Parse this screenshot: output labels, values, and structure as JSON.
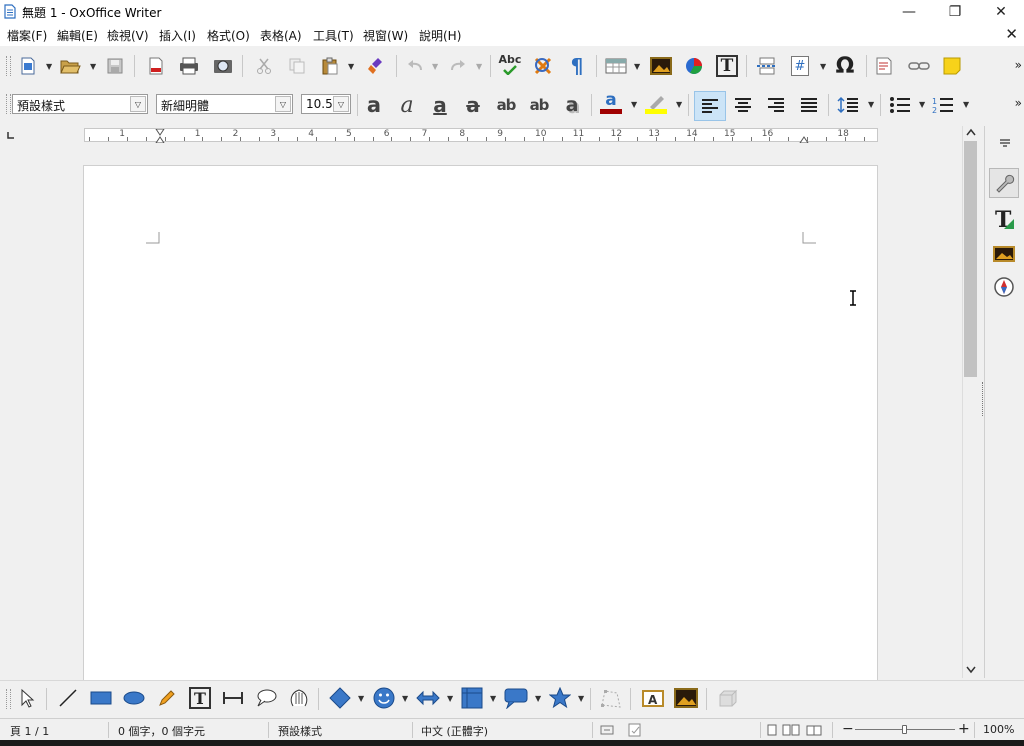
{
  "window": {
    "title": "無題 1 - OxOffice Writer",
    "minimize_glyph": "—",
    "restore_glyph": "❐",
    "close_glyph": "✕"
  },
  "menu": {
    "items": [
      "檔案(F)",
      "編輯(E)",
      "檢視(V)",
      "插入(I)",
      "格式(O)",
      "表格(A)",
      "工具(T)",
      "視窗(W)",
      "說明(H)"
    ],
    "close_document_glyph": "✕"
  },
  "standard_toolbar": {
    "spellcheck_label": "Abc",
    "special_char_glyph": "Ω",
    "pilcrow_glyph": "¶",
    "textbox_glyph": "T",
    "field_glyph": "#",
    "more_glyph": "»"
  },
  "formatting_toolbar": {
    "paragraph_style": "預設樣式",
    "font_name": "新細明體",
    "font_size": "10.5",
    "bold_glyph": "a",
    "italic_glyph": "a",
    "underline_glyph": "a",
    "strike_glyph": "a",
    "superscript_glyph": "ab",
    "subscript_glyph": "ab",
    "shadow_glyph": "a",
    "font_color_glyph": "a",
    "font_color": "#a00000",
    "highlight_color": "#ffff00",
    "more_glyph": "»"
  },
  "ruler": {
    "numbers": [
      "1",
      "1",
      "2",
      "3",
      "4",
      "5",
      "6",
      "7",
      "8",
      "9",
      "10",
      "11",
      "12",
      "13",
      "14",
      "15",
      "16",
      "18"
    ]
  },
  "drawing_toolbar": {
    "textbox_glyph": "T"
  },
  "status": {
    "page": "頁 1 / 1",
    "word_count": "0 個字，0 個字元",
    "page_style": "預設樣式",
    "language": "中文 (正體字)",
    "zoom": "100%",
    "zoom_minus": "−",
    "zoom_plus": "+"
  },
  "colors": {
    "accent_blue": "#2e6fc0",
    "toolbar_bg": "#f0f0f0",
    "active_button_bg": "#cce4f7"
  }
}
